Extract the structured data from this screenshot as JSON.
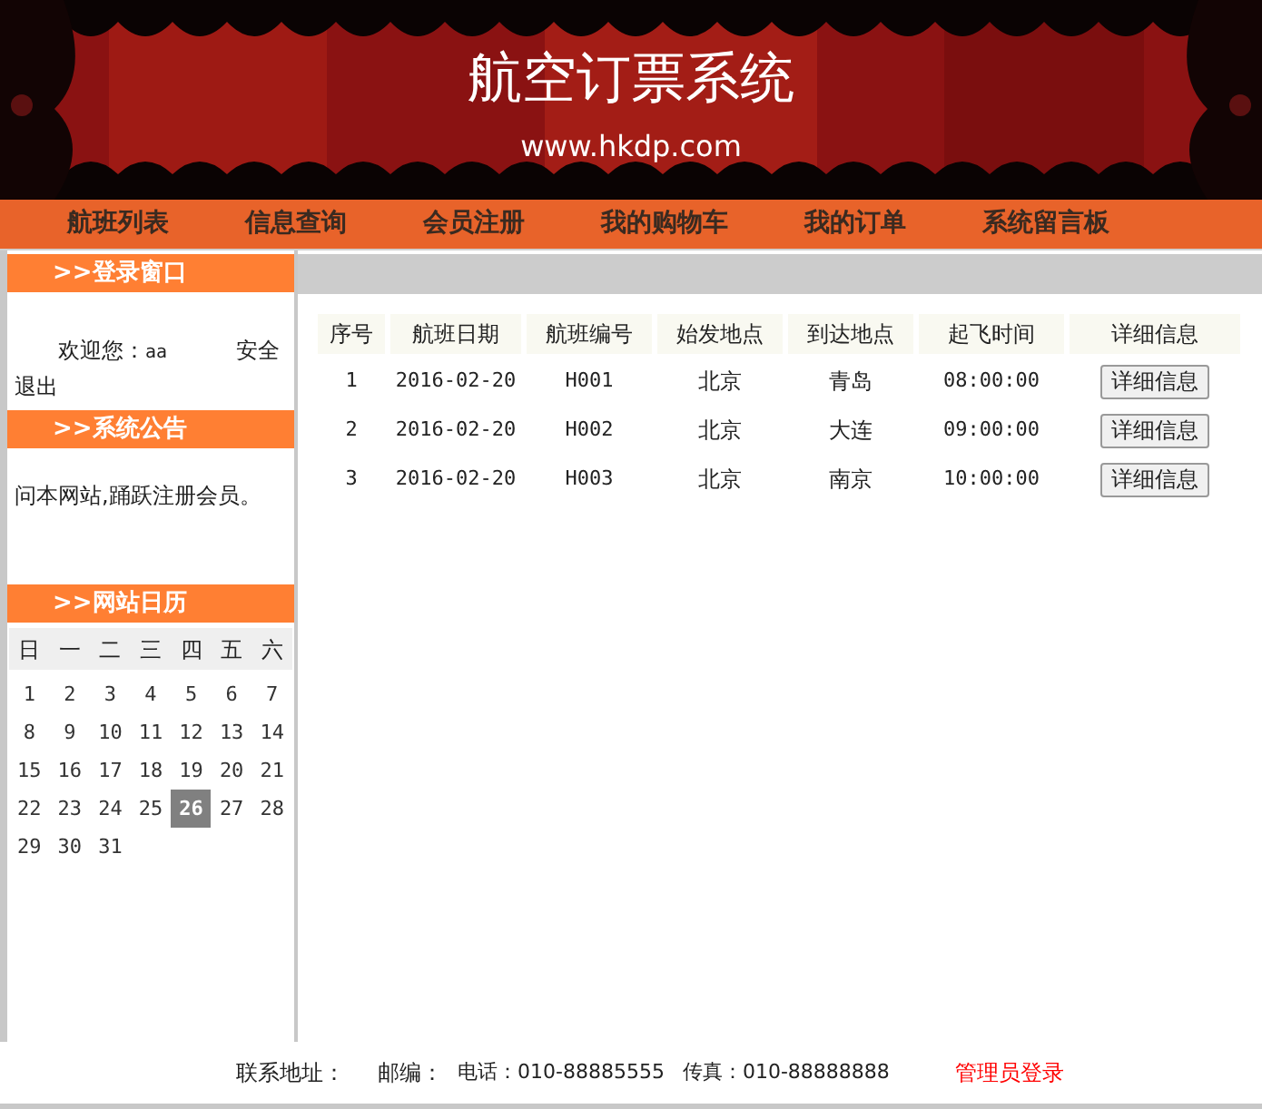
{
  "banner": {
    "title": "航空订票系统",
    "url": "www.hkdp.com"
  },
  "nav": [
    "航班列表",
    "信息查询",
    "会员注册",
    "我的购物车",
    "我的订单",
    "系统留言板"
  ],
  "login_panel": {
    "title": ">>登录窗口",
    "welcome": "欢迎您：",
    "user": "aa",
    "logout": "安全退出"
  },
  "notice_panel": {
    "title": ">>系统公告",
    "text": "问本网站,踊跃注册会员。"
  },
  "calendar_panel": {
    "title": ">>网站日历",
    "weekdays": [
      "日",
      "一",
      "二",
      "三",
      "四",
      "五",
      "六"
    ],
    "days": [
      {
        "day": "1",
        "selected": false
      },
      {
        "day": "2",
        "selected": false
      },
      {
        "day": "3",
        "selected": false
      },
      {
        "day": "4",
        "selected": false
      },
      {
        "day": "5",
        "selected": false
      },
      {
        "day": "6",
        "selected": false
      },
      {
        "day": "7",
        "selected": false
      },
      {
        "day": "8",
        "selected": false
      },
      {
        "day": "9",
        "selected": false
      },
      {
        "day": "10",
        "selected": false
      },
      {
        "day": "11",
        "selected": false
      },
      {
        "day": "12",
        "selected": false
      },
      {
        "day": "13",
        "selected": false
      },
      {
        "day": "14",
        "selected": false
      },
      {
        "day": "15",
        "selected": false
      },
      {
        "day": "16",
        "selected": false
      },
      {
        "day": "17",
        "selected": false
      },
      {
        "day": "18",
        "selected": false
      },
      {
        "day": "19",
        "selected": false
      },
      {
        "day": "20",
        "selected": false
      },
      {
        "day": "21",
        "selected": false
      },
      {
        "day": "22",
        "selected": false
      },
      {
        "day": "23",
        "selected": false
      },
      {
        "day": "24",
        "selected": false
      },
      {
        "day": "25",
        "selected": false
      },
      {
        "day": "26",
        "selected": true
      },
      {
        "day": "27",
        "selected": false
      },
      {
        "day": "28",
        "selected": false
      },
      {
        "day": "29",
        "selected": false
      },
      {
        "day": "30",
        "selected": false
      },
      {
        "day": "31",
        "selected": false
      }
    ]
  },
  "table": {
    "columns": [
      "序号",
      "航班日期",
      "航班编号",
      "始发地点",
      "到达地点",
      "起飞时间",
      "详细信息"
    ],
    "rows": [
      {
        "cells": [
          "1",
          "2016-02-20",
          "H001",
          "北京",
          "青岛",
          "08:00:00"
        ],
        "button": "详细信息"
      },
      {
        "cells": [
          "2",
          "2016-02-20",
          "H002",
          "北京",
          "大连",
          "09:00:00"
        ],
        "button": "详细信息"
      },
      {
        "cells": [
          "3",
          "2016-02-20",
          "H003",
          "北京",
          "南京",
          "10:00:00"
        ],
        "button": "详细信息"
      }
    ]
  },
  "footer": {
    "items": [
      "联系地址：",
      "邮编：",
      "电话：010-88885555",
      "传真：010-88888888"
    ],
    "admin_link": "管理员登录"
  }
}
